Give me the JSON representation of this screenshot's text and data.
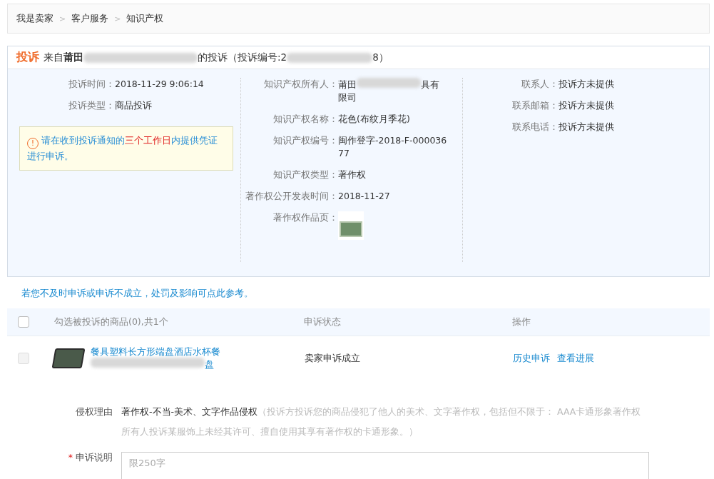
{
  "breadcrumbs": [
    "我是卖家",
    "客户服务",
    "知识产权"
  ],
  "breadcrumb_separator": ">",
  "complaint": {
    "badge": "投诉",
    "from_label": "来自",
    "from_name": "莆田",
    "from_suffix": "的投诉（投诉编号:2",
    "number_suffix": "8）"
  },
  "left_fields": [
    {
      "label": "投诉时间：",
      "value": "2018-11-29 9:06:14"
    },
    {
      "label": "投诉类型：",
      "value": "商品投诉"
    }
  ],
  "notice": {
    "icon": "!",
    "text": "请在收到投诉通知的",
    "highlight": "三个工作日",
    "text_after": "内提供凭证进行申诉。"
  },
  "owner": {
    "label": "知识产权所有人：",
    "value_start": "莆田",
    "value_end": "具有",
    "value_line2": "限司"
  },
  "middle_fields": [
    {
      "label": "知识产权名称：",
      "value": "花色(布纹月季花)",
      "kind": "text"
    },
    {
      "label": "知识产权编号：",
      "value": "闽作登字-2018-F-00003677",
      "kind": "text"
    },
    {
      "label": "知识产权类型：",
      "value": "著作权",
      "kind": "text"
    },
    {
      "label": "著作权公开发表时间：",
      "value": "2018-11-27",
      "kind": "text"
    },
    {
      "label": "著作权作品页：",
      "kind": "image"
    }
  ],
  "right_fields": [
    {
      "label": "联系人：",
      "value": "投诉方未提供"
    },
    {
      "label": "联系邮箱：",
      "value": "投诉方未提供"
    },
    {
      "label": "联系电话：",
      "value": "投诉方未提供"
    }
  ],
  "penalty_link": "若您不及时申诉或申诉不成立，处罚及影响可点此参考。",
  "table": {
    "select_all_checked": false,
    "columns": [
      "勾选被投诉的商品(0),共1个",
      "申诉状态",
      "操作"
    ],
    "rows": [
      {
        "checked": false,
        "disabled": true,
        "product": "餐具塑料长方形端盘酒店水杯餐",
        "product_line2_end": "盘",
        "status": "卖家申诉成立",
        "actions": [
          "历史申诉",
          "查看进展"
        ]
      }
    ]
  },
  "reason": {
    "label": "侵权理由",
    "value": "著作权-不当-美术、文字作品侵权",
    "note": "（投诉方投诉您的商品侵犯了他人的美术、文字著作权，包括但不限于： AAA卡通形象著作权所有人投诉某服饰上未经其许可、擅自使用其享有著作权的卡通形象。）"
  },
  "appeal": {
    "required_mark": "*",
    "label": "申诉说明",
    "placeholder": "限250字"
  }
}
